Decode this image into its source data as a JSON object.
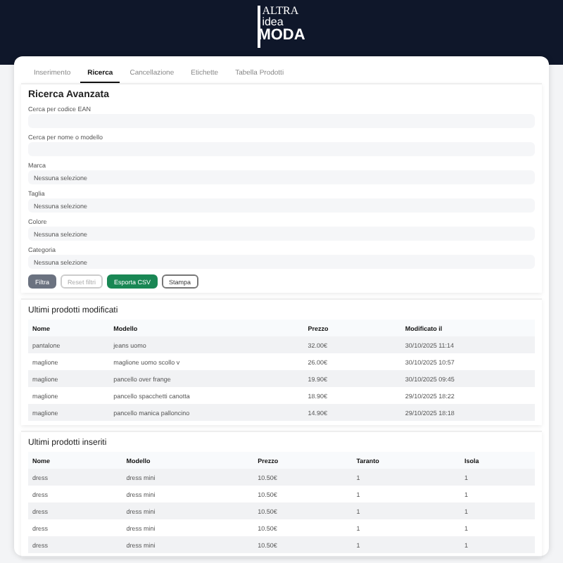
{
  "logo": {
    "line1": "ALTRA",
    "line2": "idea",
    "line3": "MODA"
  },
  "tabs": [
    {
      "label": "Inserimento",
      "selected": false
    },
    {
      "label": "Ricerca",
      "selected": true
    },
    {
      "label": "Cancellazione",
      "selected": false
    },
    {
      "label": "Etichette",
      "selected": false
    },
    {
      "label": "Tabella Prodotti",
      "selected": false
    }
  ],
  "search": {
    "title": "Ricerca Avanzata",
    "fields": [
      {
        "kind": "input",
        "label": "Cerca per codice EAN"
      },
      {
        "kind": "input",
        "label": "Cerca per nome o modello"
      },
      {
        "kind": "select",
        "label": "Marca",
        "value": "Nessuna selezione"
      },
      {
        "kind": "select",
        "label": "Taglia",
        "value": "Nessuna selezione"
      },
      {
        "kind": "select",
        "label": "Colore",
        "value": "Nessuna selezione"
      },
      {
        "kind": "select",
        "label": "Categoria",
        "value": "Nessuna selezione"
      }
    ],
    "buttons": [
      {
        "label": "Filtra",
        "kind": "secondary"
      },
      {
        "label": "Reset filtri",
        "kind": "outline-muted"
      },
      {
        "label": "Esporta CSV",
        "kind": "success"
      },
      {
        "label": "Stampa",
        "kind": "outline"
      }
    ]
  },
  "tables": [
    {
      "title": "Ultimi prodotti modificati",
      "columns": [
        "Nome",
        "Modello",
        "Prezzo",
        "Modificato il"
      ],
      "rows": [
        [
          "pantalone",
          "jeans uomo",
          "32.00€",
          "30/10/2025 11:14"
        ],
        [
          "maglione",
          "maglione uomo scollo v",
          "26.00€",
          "30/10/2025 10:57"
        ],
        [
          "maglione",
          "pancello over frange",
          "19.90€",
          "30/10/2025 09:45"
        ],
        [
          "maglione",
          "pancello spacchetti canotta",
          "18.90€",
          "29/10/2025 18:22"
        ],
        [
          "maglione",
          "pancello manica palloncino",
          "14.90€",
          "29/10/2025 18:18"
        ]
      ]
    },
    {
      "title": "Ultimi prodotti inseriti",
      "columns": [
        "Nome",
        "Modello",
        "Prezzo",
        "Taranto",
        "Isola"
      ],
      "rows": [
        [
          "dress",
          "dress mini",
          "10.50€",
          "1",
          "1"
        ],
        [
          "dress",
          "dress mini",
          "10.50€",
          "1",
          "1"
        ],
        [
          "dress",
          "dress mini",
          "10.50€",
          "1",
          "1"
        ],
        [
          "dress",
          "dress mini",
          "10.50€",
          "1",
          "1"
        ],
        [
          "dress",
          "dress mini",
          "10.50€",
          "1",
          "1"
        ]
      ]
    }
  ]
}
